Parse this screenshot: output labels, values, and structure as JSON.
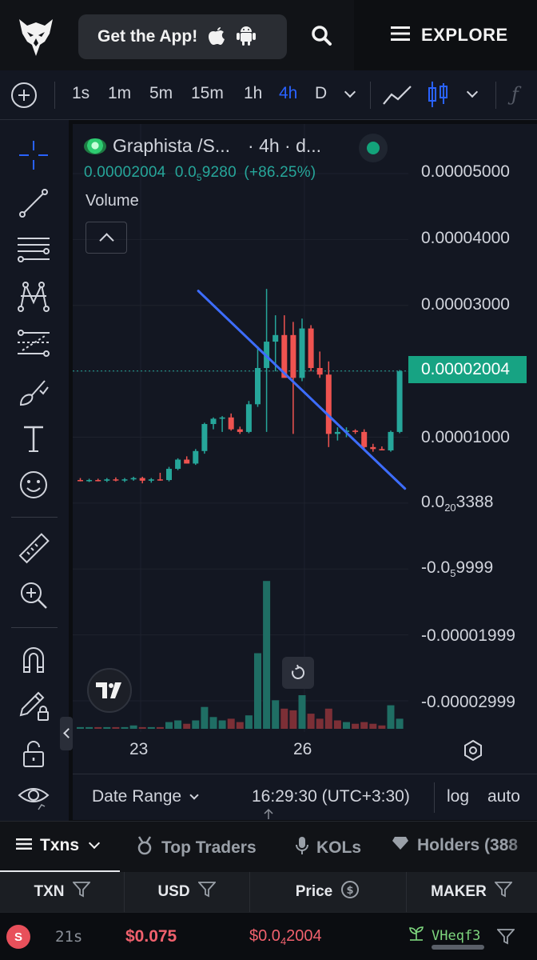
{
  "header": {
    "get_app_label": "Get the App!",
    "explore_label": "EXPLORE"
  },
  "timeframes": [
    {
      "label": "1s",
      "active": false
    },
    {
      "label": "1m",
      "active": false
    },
    {
      "label": "5m",
      "active": false
    },
    {
      "label": "15m",
      "active": false
    },
    {
      "label": "1h",
      "active": false
    },
    {
      "label": "4h",
      "active": true
    },
    {
      "label": "D",
      "active": false
    }
  ],
  "toolbar_icons": [
    "plus-circle-icon",
    "chevron-down-icon",
    "line-chart-icon",
    "candlestick-icon",
    "fx-icon"
  ],
  "left_tools": [
    "crosshair-icon",
    "trendline-icon",
    "horizontal-lines-icon",
    "pattern-icon",
    "fib-icon",
    "brush-icon",
    "text-icon",
    "emoji-icon",
    "ruler-icon",
    "zoom-in-icon",
    "magnet-icon",
    "pencil-lock-icon",
    "lock-icon",
    "eye-icon"
  ],
  "legend": {
    "symbol": "Graphista /S...",
    "interval": "· 4h · d...",
    "last_price": "0.00002004",
    "change_prefix": "0.0",
    "change_sub": "5",
    "change_rest": "9280",
    "change_pct": "(+86.25%)",
    "volume_label": "Volume"
  },
  "price_axis": [
    {
      "text": "0.00005000"
    },
    {
      "text": "0.00004000"
    },
    {
      "text": "0.00003000"
    },
    {
      "text": "0.00001000"
    },
    {
      "pre": "0.0",
      "sub": "20",
      "post": "3388"
    },
    {
      "pre": "-0.0",
      "sub": "5",
      "post": "9999"
    },
    {
      "text": "-0.00001999"
    },
    {
      "text": "-0.00002999"
    }
  ],
  "current_price_tag": "0.00002004",
  "x_axis": [
    "23",
    "26"
  ],
  "bottom_bar": {
    "date_range_label": "Date Range",
    "clock": "16:29:30 (UTC+3:30)",
    "log_label": "log",
    "auto_label": "auto"
  },
  "tabs": [
    {
      "label": "Txns",
      "active": true
    },
    {
      "label": "Top Traders",
      "active": false
    },
    {
      "label": "KOLs",
      "active": false
    },
    {
      "label": "Holders (388",
      "active": false
    }
  ],
  "table": {
    "headers": [
      "TXN",
      "USD",
      "Price",
      "MAKER"
    ],
    "rows": [
      {
        "type": "S",
        "age": "21s",
        "usd": "$0.075",
        "price_pre": "$0.0",
        "price_sub": "4",
        "price_post": "2004",
        "maker": "VHeqf3"
      }
    ]
  },
  "colors": {
    "up": "#26a69a",
    "down": "#ef5350",
    "accent": "#2962ff",
    "trendline": "#3d6dff",
    "price_tag": "#17a383"
  },
  "chart_data": {
    "type": "candlestick",
    "title": "",
    "ylim": [
      -3e-05,
      5e-05
    ],
    "x_ticks": [
      "23",
      "26"
    ],
    "candles": [
      {
        "o": 3.5e-06,
        "h": 3.8e-06,
        "l": 3.3e-06,
        "c": 3.4e-06
      },
      {
        "o": 3.4e-06,
        "h": 3.7e-06,
        "l": 3.2e-06,
        "c": 3.5e-06
      },
      {
        "o": 3.5e-06,
        "h": 3.7e-06,
        "l": 3.3e-06,
        "c": 3.4e-06
      },
      {
        "o": 3.4e-06,
        "h": 3.8e-06,
        "l": 3.2e-06,
        "c": 3.6e-06
      },
      {
        "o": 3.6e-06,
        "h": 3.9e-06,
        "l": 3.3e-06,
        "c": 3.5e-06
      },
      {
        "o": 3.5e-06,
        "h": 3.8e-06,
        "l": 3.2e-06,
        "c": 3.6e-06
      },
      {
        "o": 3.6e-06,
        "h": 4e-06,
        "l": 3.4e-06,
        "c": 3.8e-06
      },
      {
        "o": 3.8e-06,
        "h": 4e-06,
        "l": 3e-06,
        "c": 3.4e-06
      },
      {
        "o": 3.4e-06,
        "h": 3.8e-06,
        "l": 3.1e-06,
        "c": 3.6e-06
      },
      {
        "o": 3.6e-06,
        "h": 4.6e-06,
        "l": 3.4e-06,
        "c": 3.5e-06
      },
      {
        "o": 3.5e-06,
        "h": 5.5e-06,
        "l": 3.3e-06,
        "c": 5.2e-06
      },
      {
        "o": 5.2e-06,
        "h": 6.8e-06,
        "l": 5e-06,
        "c": 6.6e-06
      },
      {
        "o": 6.6e-06,
        "h": 7.1e-06,
        "l": 6e-06,
        "c": 6e-06
      },
      {
        "o": 6e-06,
        "h": 8.2e-06,
        "l": 5.8e-06,
        "c": 7.9e-06
      },
      {
        "o": 7.9e-06,
        "h": 1.22e-05,
        "l": 7.5e-06,
        "c": 1.2e-05
      },
      {
        "o": 1.2e-05,
        "h": 1.3e-05,
        "l": 1.12e-05,
        "c": 1.28e-05
      },
      {
        "o": 1.28e-05,
        "h": 1.32e-05,
        "l": 1.08e-05,
        "c": 1.3e-05
      },
      {
        "o": 1.3e-05,
        "h": 1.36e-05,
        "l": 1.1e-05,
        "c": 1.12e-05
      },
      {
        "o": 1.12e-05,
        "h": 1.16e-05,
        "l": 1.05e-05,
        "c": 1.08e-05
      },
      {
        "o": 1.08e-05,
        "h": 1.55e-05,
        "l": 1.06e-05,
        "c": 1.5e-05
      },
      {
        "o": 1.5e-05,
        "h": 2.38e-05,
        "l": 1.46e-05,
        "c": 2.05e-05
      },
      {
        "o": 2.05e-05,
        "h": 3.25e-05,
        "l": 1.08e-05,
        "c": 2.45e-05
      },
      {
        "o": 2.45e-05,
        "h": 2.85e-05,
        "l": 2e-05,
        "c": 2.55e-05
      },
      {
        "o": 2.55e-05,
        "h": 2.85e-05,
        "l": 2.05e-05,
        "c": 1.9e-05
      },
      {
        "o": 2.55e-05,
        "h": 2.75e-05,
        "l": 1.05e-05,
        "c": 1.9e-05
      },
      {
        "o": 1.9e-05,
        "h": 2.8e-05,
        "l": 1.85e-05,
        "c": 2.65e-05
      },
      {
        "o": 2.65e-05,
        "h": 2.7e-05,
        "l": 2e-05,
        "c": 2.05e-05
      },
      {
        "o": 2.05e-05,
        "h": 2.3e-05,
        "l": 1.9e-05,
        "c": 1.95e-05
      },
      {
        "o": 1.95e-05,
        "h": 2.15e-05,
        "l": 8.5e-06,
        "c": 1.05e-05
      },
      {
        "o": 1.05e-05,
        "h": 1.15e-05,
        "l": 9.5e-06,
        "c": 1.08e-05
      },
      {
        "o": 1.08e-05,
        "h": 1.15e-05,
        "l": 1e-05,
        "c": 1.1e-05
      },
      {
        "o": 1.1e-05,
        "h": 1.12e-05,
        "l": 1.05e-05,
        "c": 1.08e-05
      },
      {
        "o": 1.08e-05,
        "h": 1.12e-05,
        "l": 8e-06,
        "c": 8.5e-06
      },
      {
        "o": 8.5e-06,
        "h": 9e-06,
        "l": 7.8e-06,
        "c": 8.2e-06
      },
      {
        "o": 8.2e-06,
        "h": 8.6e-06,
        "l": 8e-06,
        "c": 8e-06
      },
      {
        "o": 8e-06,
        "h": 1.1e-05,
        "l": 7.8e-06,
        "c": 1.08e-05
      },
      {
        "o": 1.08e-05,
        "h": 2.02e-05,
        "l": 1.06e-05,
        "c": 2e-05
      }
    ],
    "volume": [
      {
        "v": 1,
        "up": true
      },
      {
        "v": 1,
        "up": true
      },
      {
        "v": 1,
        "up": false
      },
      {
        "v": 1,
        "up": true
      },
      {
        "v": 1,
        "up": false
      },
      {
        "v": 1,
        "up": true
      },
      {
        "v": 2,
        "up": true
      },
      {
        "v": 1,
        "up": false
      },
      {
        "v": 1,
        "up": true
      },
      {
        "v": 1,
        "up": false
      },
      {
        "v": 4,
        "up": true
      },
      {
        "v": 5,
        "up": true
      },
      {
        "v": 3,
        "up": false
      },
      {
        "v": 5,
        "up": true
      },
      {
        "v": 13,
        "up": true
      },
      {
        "v": 7,
        "up": true
      },
      {
        "v": 5,
        "up": true
      },
      {
        "v": 6,
        "up": false
      },
      {
        "v": 4,
        "up": false
      },
      {
        "v": 8,
        "up": true
      },
      {
        "v": 45,
        "up": true
      },
      {
        "v": 88,
        "up": true
      },
      {
        "v": 17,
        "up": true
      },
      {
        "v": 12,
        "up": false
      },
      {
        "v": 11,
        "up": false
      },
      {
        "v": 20,
        "up": true
      },
      {
        "v": 9,
        "up": false
      },
      {
        "v": 6,
        "up": false
      },
      {
        "v": 12,
        "up": false
      },
      {
        "v": 5,
        "up": false
      },
      {
        "v": 4,
        "up": true
      },
      {
        "v": 3,
        "up": false
      },
      {
        "v": 4,
        "up": false
      },
      {
        "v": 3,
        "up": false
      },
      {
        "v": 2,
        "up": false
      },
      {
        "v": 14,
        "up": true
      },
      {
        "v": 6,
        "up": true
      }
    ],
    "trendline": [
      {
        "i": 13.3,
        "p": 3.22e-05
      },
      {
        "i": 36.6,
        "p": 2.2e-06
      }
    ],
    "last_price_line": 2.004e-05,
    "grid": true
  }
}
